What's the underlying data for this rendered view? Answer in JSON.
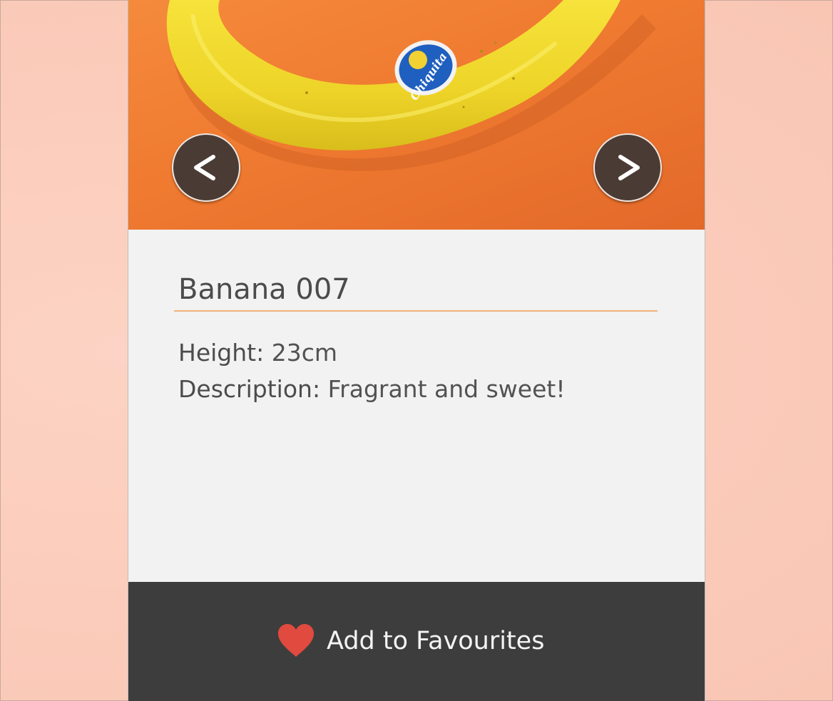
{
  "gallery": {
    "prev_label": "<",
    "next_label": ">",
    "sticker_text": "Chiquita"
  },
  "item": {
    "title": "Banana 007",
    "height_label": "Height:",
    "height_value": "23cm",
    "description_label": "Description:",
    "description_value": "Fragrant and sweet!"
  },
  "actions": {
    "favourite_label": "Add to Favourites"
  },
  "colors": {
    "backdrop": "#fbcdbd",
    "photo_background": "#ef7a30",
    "banana": "#f2dc2a",
    "nav_button": "#4a3b35",
    "panel": "#f2f2f2",
    "title_rule": "#f0b27a",
    "footer": "#3d3d3d",
    "heart": "#e04a3f"
  },
  "icons": {
    "prev": "chevron-left-icon",
    "next": "chevron-right-icon",
    "favourite": "heart-icon"
  }
}
